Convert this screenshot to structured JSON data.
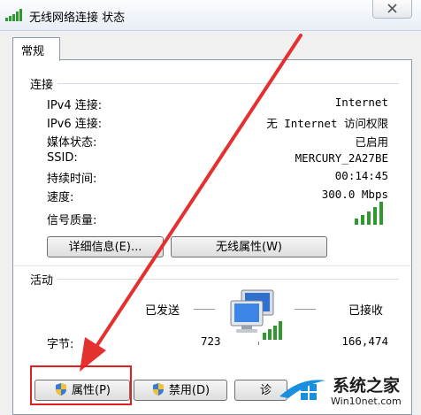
{
  "window": {
    "title": "无线网络连接 状态"
  },
  "tabs": [
    {
      "label": "常规"
    }
  ],
  "connection": {
    "group_label": "连接",
    "rows": [
      {
        "label": "IPv4 连接:",
        "value": "Internet"
      },
      {
        "label": "IPv6 连接:",
        "value": "无 Internet 访问权限"
      },
      {
        "label": "媒体状态:",
        "value": "已启用"
      },
      {
        "label": "SSID:",
        "value": "MERCURY_2A27BE"
      },
      {
        "label": "持续时间:",
        "value": "00:14:45"
      },
      {
        "label": "速度:",
        "value": "300.0 Mbps"
      }
    ],
    "signal_label": "信号质量:",
    "signal_bars": 5,
    "details_button": "详细信息(E)...",
    "wireless_button": "无线属性(W)"
  },
  "activity": {
    "group_label": "活动",
    "sent_label": "已发送",
    "received_label": "已接收",
    "bytes_label": "字节:",
    "bytes_sent": "723",
    "bytes_received": "166,474"
  },
  "buttons": {
    "properties": "属性(P)",
    "disable": "禁用(D)",
    "diagnose": "诊"
  },
  "watermark": {
    "text": "系统之家",
    "url": "Win10net.com"
  },
  "colors": {
    "signal": "#2e9a2e",
    "highlight_box": "#e02020",
    "arrow": "#e53030"
  }
}
